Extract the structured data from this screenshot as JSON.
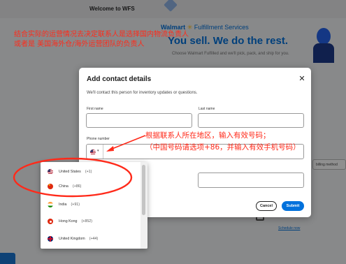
{
  "background": {
    "welcome": "Welcome to WFS",
    "brand": "Walmart",
    "brand_suffix": "Fulfillment Services",
    "tagline": "You sell. We do the rest.",
    "description": "Choose Walmart Fulfilled and we'll pick, pack, and ship for you.",
    "side_box_label": "billing method",
    "bottom_link": "Schedule now"
  },
  "annotations": {
    "top_line1": "结合实际的运营情况去决定联系人是选择国内物流负责人",
    "top_line2": "或者是  美国海外仓/海外运营团队的负责人",
    "mid_line1": "根据联系人所在地区，输入有效号码；",
    "mid_line2": "（中国号码请选项+86，并输入有效手机号码）"
  },
  "modal": {
    "title": "Add contact details",
    "subtitle": "We'll contact this person for inventory updates or questions.",
    "first_name_label": "First name",
    "last_name_label": "Last name",
    "phone_label": "Phone number",
    "cancel_label": "Cancel",
    "submit_label": "Submit"
  },
  "country_dropdown": {
    "items": [
      {
        "name": "United States",
        "code": "(+1)",
        "flag": "us-flag-icon"
      },
      {
        "name": "China",
        "code": "(+86)",
        "flag": "china-flag-icon"
      },
      {
        "name": "India",
        "code": "(+91)",
        "flag": "india-flag-icon"
      },
      {
        "name": "Hong Kong",
        "code": "(+852)",
        "flag": "hong-kong-flag-icon"
      },
      {
        "name": "United Kingdom",
        "code": "(+44)",
        "flag": "uk-flag-icon"
      }
    ]
  },
  "colors": {
    "annotation_red": "#ff2a1a",
    "walmart_blue": "#0071dc",
    "walmart_yellow": "#ffc220"
  }
}
